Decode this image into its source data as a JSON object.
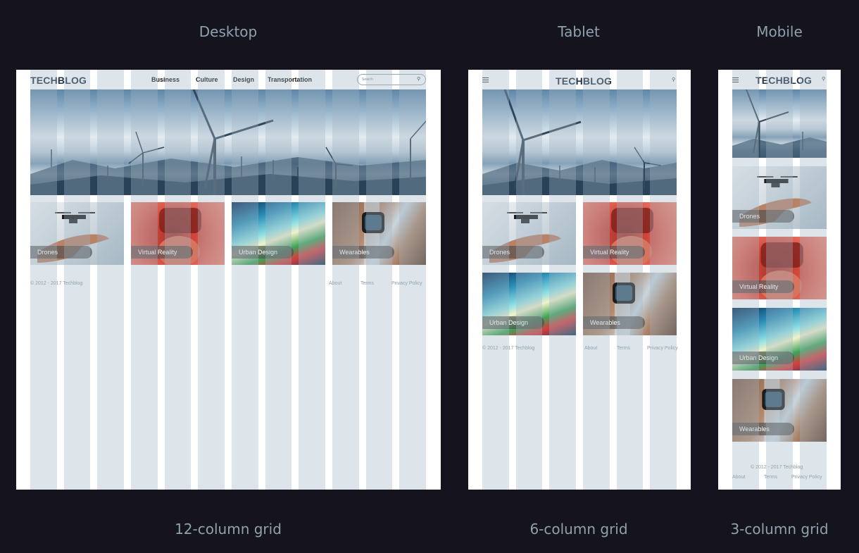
{
  "captions": {
    "desktop_title": "Desktop",
    "tablet_title": "Tablet",
    "mobile_title": "Mobile",
    "desktop_grid": "12-column grid",
    "tablet_grid": "6-column grid",
    "mobile_grid": "3-column grid"
  },
  "site": {
    "logo": "TECHBLOG",
    "nav": [
      "Business",
      "Culture",
      "Design",
      "Transportation"
    ],
    "search_placeholder": "Search",
    "categories": [
      "Drones",
      "Virtual Reality",
      "Urban Design",
      "Wearables"
    ],
    "copyright": "© 2012 - 2017 Techblog",
    "footer_links": [
      "About",
      "Terms",
      "Privacy Policy"
    ]
  },
  "grid": {
    "desktop_columns": 12,
    "tablet_columns": 6,
    "mobile_columns": 3
  },
  "icons": {
    "search": "search-icon",
    "menu": "hamburger-menu-icon"
  },
  "colors": {
    "page_background": "#15141e",
    "caption": "#8fa1ad",
    "logo": "#213447",
    "grid_overlay": "rgba(160,180,195,0.35)"
  }
}
